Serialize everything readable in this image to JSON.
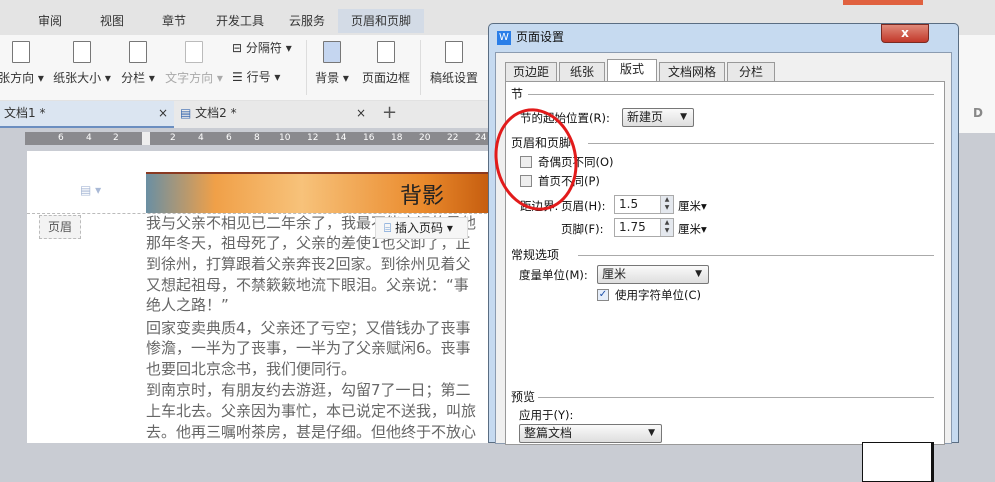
{
  "menu_tabs": [
    "审阅",
    "视图",
    "章节",
    "开发工具",
    "云服务",
    "页眉和页脚"
  ],
  "ribbon": {
    "orientation": "张方向",
    "paper_size": "纸张大小",
    "columns": "分栏",
    "text_direction": "文字方向",
    "separator": "分隔符",
    "line_number": "行号",
    "background": "背景",
    "page_border": "页面边框",
    "grid_paper": "稿纸设置"
  },
  "doc_tabs": [
    "文档1 *",
    "文档2 *"
  ],
  "ruler_ticks": [
    "6",
    "4",
    "2",
    "2",
    "4",
    "6",
    "8",
    "10",
    "12",
    "14",
    "16",
    "18",
    "20",
    "22",
    "24"
  ],
  "document": {
    "header_title": "背影",
    "header_label": "页眉",
    "insert_page_number": "插入页码",
    "lines": [
      "我与父亲不相见已二年余了，我最不能忘记的是他",
      "那年冬天，祖母死了，父亲的差使1也交卸了，正",
      "到徐州，打算跟着父亲奔丧2回家。到徐州见着父",
      "又想起祖母，不禁簌簌地流下眼泪。父亲说：“事",
      "绝人之路！”",
      "回家变卖典质4，父亲还了亏空；又借钱办了丧事",
      "惨澹，一半为了丧事，一半为了父亲赋闲6。丧事",
      "也要回北京念书，我们便同行。",
      "到南京时，有朋友约去游逛，勾留7了一日；第二",
      "上车北去。父亲因为事忙，本已说定不送我，叫旅",
      "去。他再三嘱咐茶房，甚是仔细。但他终于不放心"
    ]
  },
  "dialog": {
    "title": "页面设置",
    "close": "x",
    "tabs": [
      "页边距",
      "纸张",
      "版式",
      "文档网格",
      "分栏"
    ],
    "active_tab": "版式",
    "section": {
      "title": "节",
      "start_label": "节的起始位置(R):",
      "start_value": "新建页"
    },
    "header_footer": {
      "title": "页眉和页脚",
      "odd_even": "奇偶页不同(O)",
      "first_page": "首页不同(P)",
      "distance_label": "距边界:",
      "header_label": "页眉(H):",
      "header_value": "1.5",
      "footer_label": "页脚(F):",
      "footer_value": "1.75",
      "unit": "厘米"
    },
    "general": {
      "title": "常规选项",
      "measure_label": "度量单位(M):",
      "measure_value": "厘米",
      "use_char_unit": "使用字符单位(C)"
    },
    "preview": {
      "title": "预览",
      "apply_label": "应用于(Y):",
      "apply_value": "整篇文档"
    }
  },
  "colors": {
    "accent": "#2a7ee8",
    "annotation": "#e21b1b"
  }
}
